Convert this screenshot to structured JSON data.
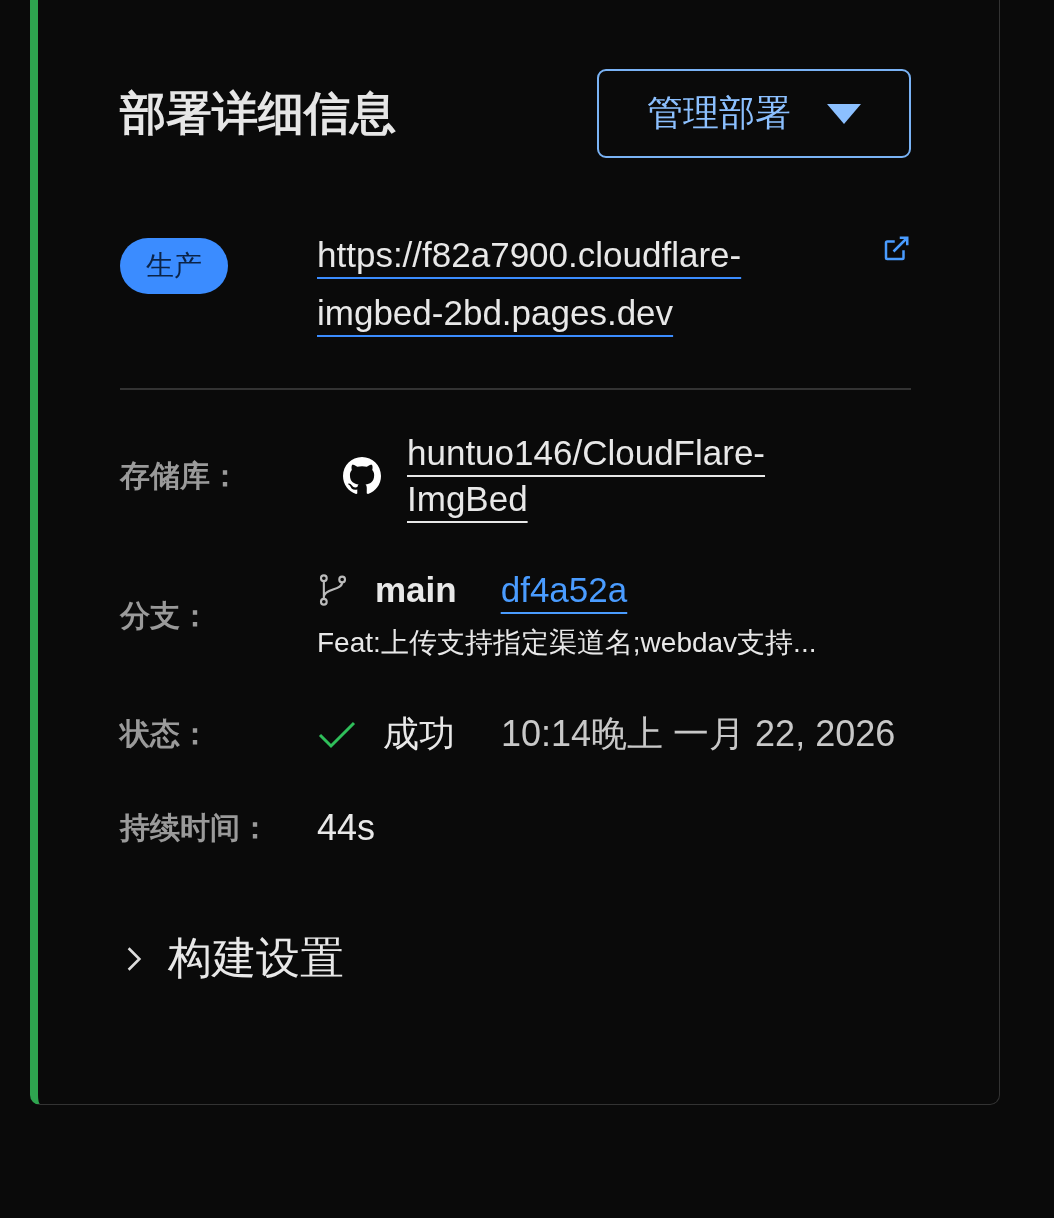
{
  "title": "部署详细信息",
  "manage_button": {
    "label": "管理部署"
  },
  "environment": {
    "badge": "生产",
    "url": "https://f82a7900.cloudflare-imgbed-2bd.pages.dev"
  },
  "details": [
    {
      "kind": "repo",
      "label": "存储库：",
      "value": "huntuo146/CloudFlare-ImgBed"
    },
    {
      "kind": "branch",
      "label": "分支：",
      "branch": "main",
      "commit": "df4a52a",
      "message": "Feat:上传支持指定渠道名;webdav支持..."
    },
    {
      "kind": "status",
      "label": "状态：",
      "value": "成功",
      "time": "10:14晚上 一月 22, 2026"
    },
    {
      "kind": "duration",
      "label": "持续时间：",
      "value": "44s"
    }
  ],
  "build_settings": {
    "label": "构建设置",
    "expanded": false
  }
}
